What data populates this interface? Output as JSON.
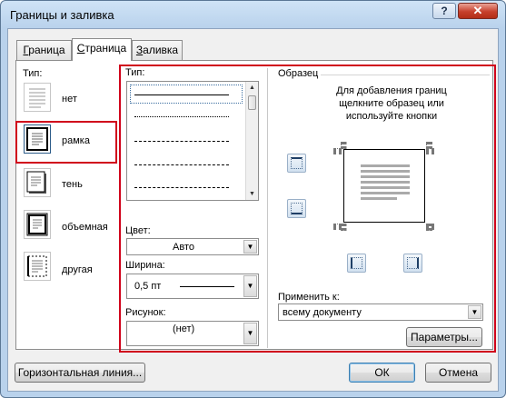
{
  "window": {
    "title": "Границы и заливка",
    "help_glyph": "?",
    "close_glyph": "✕"
  },
  "tabs": [
    {
      "label": "Граница",
      "accel": "Г",
      "rest": "раница"
    },
    {
      "label": "Страница",
      "accel": "С",
      "rest": "траница"
    },
    {
      "label": "Заливка",
      "accel": "З",
      "rest": "аливка"
    }
  ],
  "type_section": {
    "heading": "Тип:",
    "items": [
      {
        "label": "нет",
        "icon": "none-border-icon"
      },
      {
        "label": "рамка",
        "icon": "box-border-icon"
      },
      {
        "label": "тень",
        "icon": "shadow-border-icon"
      },
      {
        "label": "объемная",
        "icon": "3d-border-icon"
      },
      {
        "label": "другая",
        "icon": "custom-border-icon"
      }
    ],
    "selected": "рамка"
  },
  "style_section": {
    "heading": "Тип:",
    "line_styles": [
      "solid",
      "dotted",
      "dashed-fine",
      "dashed",
      "dash-dot"
    ]
  },
  "color": {
    "label": "Цвет:",
    "value": "Авто"
  },
  "width": {
    "label": "Ширина:",
    "value": "0,5 пт"
  },
  "art": {
    "label": "Рисунок:",
    "value": "(нет)"
  },
  "preview": {
    "heading": "Образец",
    "hint": "Для добавления границ щелкните образец или используйте кнопки"
  },
  "apply_to": {
    "label": "Применить к:",
    "value": "всему документу"
  },
  "buttons": {
    "options": "Параметры...",
    "horizontal_line": "Горизонтальная линия...",
    "ok": "ОК",
    "cancel": "Отмена"
  },
  "colors": {
    "highlight": "#d0021b",
    "title_bar": "#b9d2ec",
    "default_button_border": "#3c7fb1"
  }
}
